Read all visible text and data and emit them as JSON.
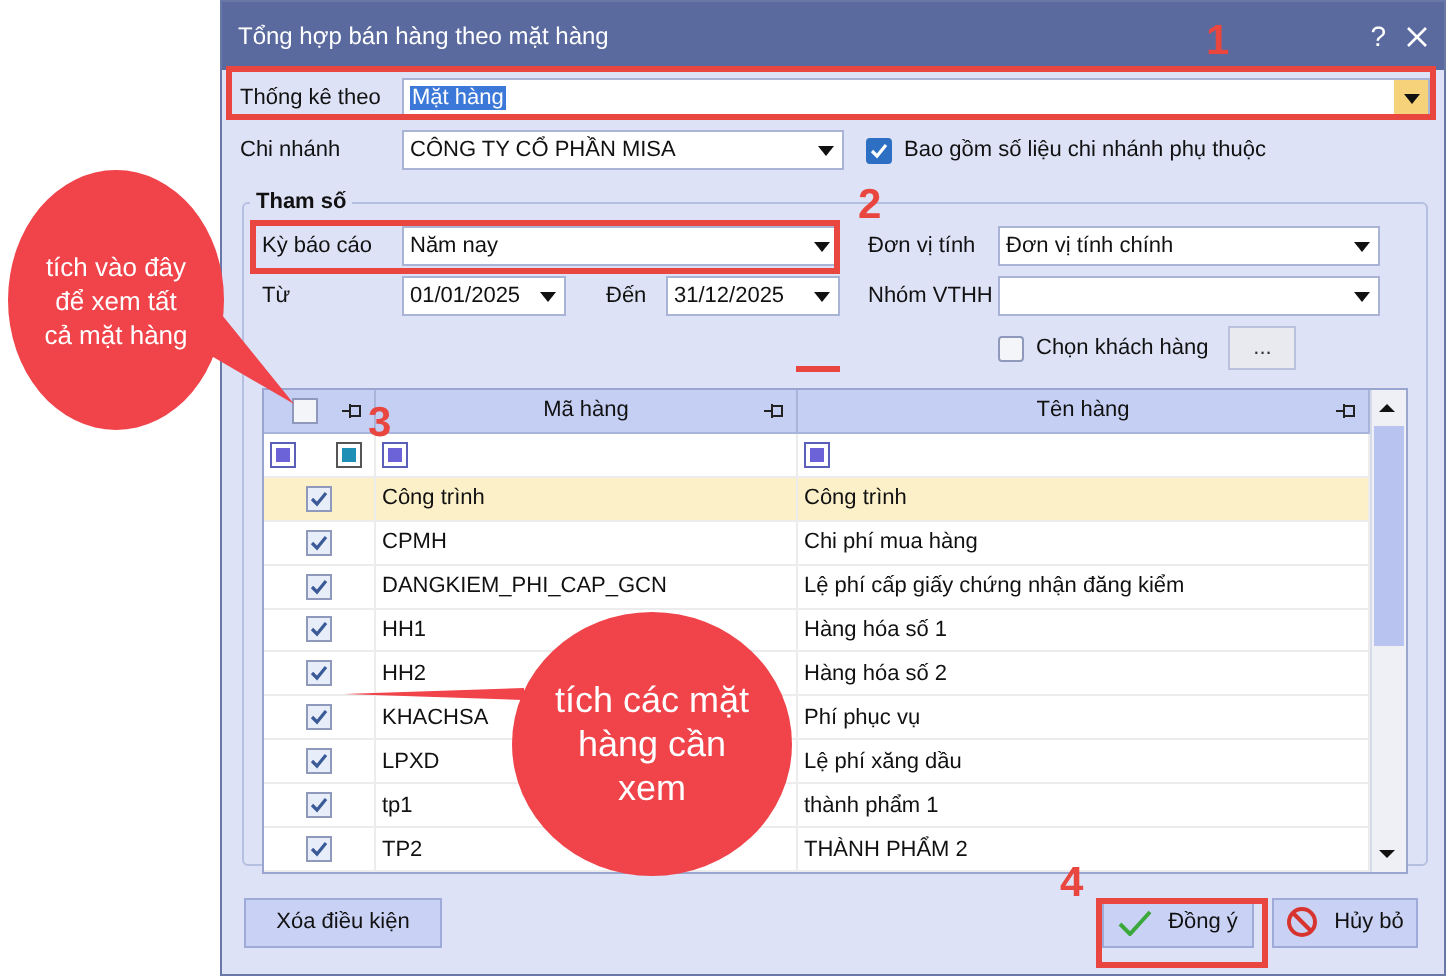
{
  "dialog": {
    "title": "Tổng hợp bán hàng theo mặt hàng",
    "help": "?"
  },
  "group_by": {
    "label": "Thống kê theo",
    "value": "Mặt hàng"
  },
  "branch": {
    "label": "Chi nhánh",
    "value": "CÔNG TY CỔ PHẦN MISA"
  },
  "include_dependent": {
    "label": "Bao gồm số liệu chi nhánh phụ thuộc",
    "checked": true
  },
  "params": {
    "title": "Tham số",
    "period": {
      "label": "Kỳ báo cáo",
      "value": "Năm nay"
    },
    "from": {
      "label": "Từ",
      "value": "01/01/2025"
    },
    "to": {
      "label": "Đến",
      "value": "31/12/2025"
    },
    "unit": {
      "label": "Đơn vị tính",
      "value": "Đơn vị tính chính"
    },
    "group": {
      "label": "Nhóm VTHH"
    },
    "choose_customer": {
      "label": "Chọn khách hàng",
      "checked": false
    },
    "browse": "..."
  },
  "table": {
    "select_all_checked": false,
    "columns": [
      "Mã hàng",
      "Tên hàng"
    ],
    "rows": [
      {
        "code": "Công trình",
        "name": "Công trình",
        "checked": true,
        "selected": true
      },
      {
        "code": "CPMH",
        "name": "Chi phí mua hàng",
        "checked": true,
        "selected": false
      },
      {
        "code": "DANGKIEM_PHI_CAP_GCN",
        "name": "Lệ phí cấp giấy chứng nhận đăng kiểm",
        "checked": true,
        "selected": false
      },
      {
        "code": "HH1",
        "name": "Hàng hóa số 1",
        "checked": true,
        "selected": false
      },
      {
        "code": "HH2",
        "name": "Hàng hóa số 2",
        "checked": true,
        "selected": false
      },
      {
        "code": "KHACHSA",
        "name": "Phí phục vụ",
        "checked": true,
        "selected": false
      },
      {
        "code": "LPXD",
        "name": "Lệ phí xăng dầu",
        "checked": true,
        "selected": false
      },
      {
        "code": "tp1",
        "name": "thành phẩm 1",
        "checked": true,
        "selected": false
      },
      {
        "code": "TP2",
        "name": "THÀNH PHẨM 2",
        "checked": true,
        "selected": false
      }
    ]
  },
  "buttons": {
    "clear": "Xóa điều kiện",
    "ok": "Đồng ý",
    "cancel": "Hủy bỏ"
  },
  "annotations": {
    "steps": [
      "1",
      "2",
      "3",
      "4"
    ],
    "callouts": [
      "tích vào đây để xem tất cả mặt hàng",
      "tích các mặt hàng cần xem"
    ]
  }
}
